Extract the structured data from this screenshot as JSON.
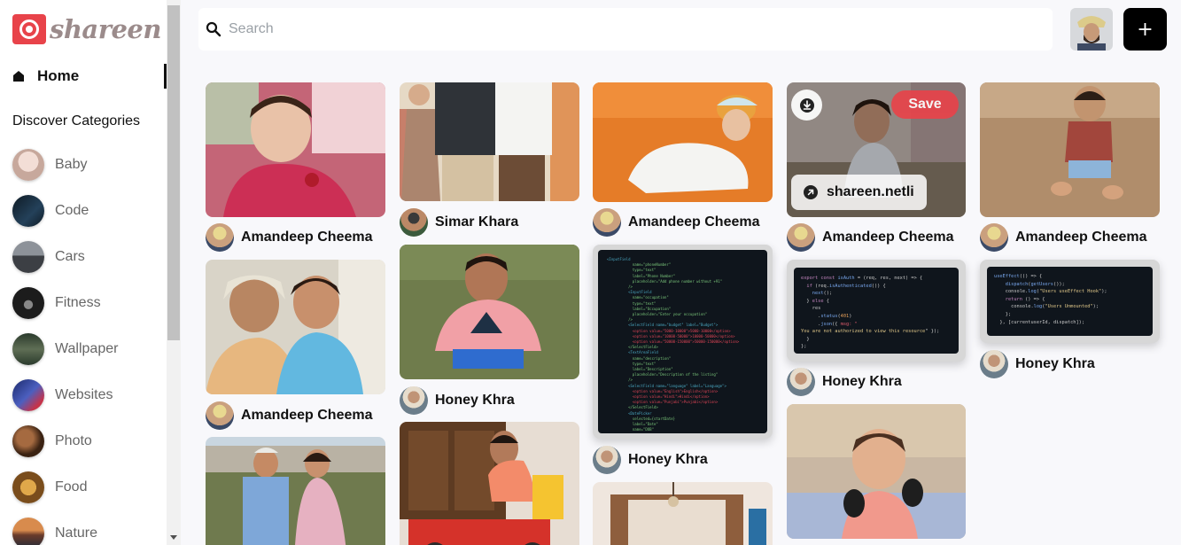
{
  "app": {
    "brand": "shareen",
    "accent": "#e8434a"
  },
  "sidebar": {
    "home_label": "Home",
    "discover_title": "Discover Categories",
    "categories": [
      {
        "label": "Baby",
        "thumb_color": "#d9c8c2"
      },
      {
        "label": "Code",
        "thumb_color": "#1d2b38"
      },
      {
        "label": "Cars",
        "thumb_color": "#5b5f66"
      },
      {
        "label": "Fitness",
        "thumb_color": "#2c2c2c"
      },
      {
        "label": "Wallpaper",
        "thumb_color": "#3a4a3b"
      },
      {
        "label": "Websites",
        "thumb_color": "#2d3b7a"
      },
      {
        "label": "Photo",
        "thumb_color": "#6b3e24"
      },
      {
        "label": "Food",
        "thumb_color": "#a7742e"
      },
      {
        "label": "Nature",
        "thumb_color": "#b76e3e"
      }
    ]
  },
  "header": {
    "search_placeholder": "Search",
    "search_value": "",
    "add_label": "+"
  },
  "pins": [
    {
      "author": "Amandeep Cheema"
    },
    {
      "author": "Amandeep Cheema"
    },
    {
      "author": "Simar Khara"
    },
    {
      "author": "Honey Khra"
    },
    {
      "author": "Amandeep Cheema"
    },
    {
      "author": "Honey Khra"
    },
    {
      "author": "Amandeep Cheema",
      "save_label": "Save",
      "link_label": "shareen.netli"
    },
    {
      "author": "Honey Khra"
    },
    {
      "author": "Amandeep Cheema"
    },
    {
      "author": "Honey Khra"
    }
  ],
  "code_snippets": {
    "express": [
      "export const isAuth = (req, res, next) => {",
      "  if (req.isAuthenticated()) {",
      "    next();",
      "  } else {",
      "    res",
      "      .status(401)",
      "      .json({ msg: \"",
      "You are not authorized to view this resource\" });",
      "  }",
      "};"
    ],
    "react": [
      "useEffect(() => {",
      "    dispatch(getUsers());",
      "    console.log(\"Users useEffect Hook\");",
      "    return () => {",
      "      console.log(\"Users Unmounted\");",
      "    };",
      "  }, [currentuserId, dispatch]);"
    ]
  }
}
